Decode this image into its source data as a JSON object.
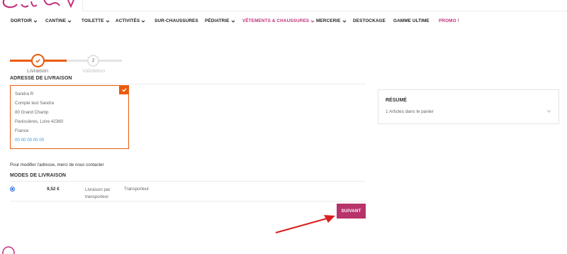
{
  "nav": {
    "items": [
      {
        "label": "DORTOIR",
        "has_dropdown": true
      },
      {
        "label": "CANTINE",
        "has_dropdown": true
      },
      {
        "label": "TOILETTE",
        "has_dropdown": true
      },
      {
        "label": "ACTIVITÉS",
        "has_dropdown": true
      },
      {
        "label": "SUR-CHAUSSURES",
        "has_dropdown": false
      },
      {
        "label": "PÉDIATRIE",
        "has_dropdown": true
      },
      {
        "label": "VÊTEMENTS & CHAUSSURES",
        "has_dropdown": true,
        "highlighted": true
      },
      {
        "label": "MERCERIE",
        "has_dropdown": true
      },
      {
        "label": "DESTOCKAGE",
        "has_dropdown": false
      },
      {
        "label": "GAMME ULTIME",
        "has_dropdown": false
      },
      {
        "label": "PROMO !",
        "has_dropdown": false,
        "highlighted": true
      }
    ]
  },
  "stepper": {
    "steps": [
      {
        "label": "Livraison",
        "state": "completed",
        "icon": "check-icon"
      },
      {
        "label": "Validation",
        "number": "2",
        "state": "pending"
      }
    ]
  },
  "shipping": {
    "title": "ADRESSE DE LIVRAISON",
    "address": {
      "name": "Sandra R",
      "company": "Compte test Sandra",
      "street": "80 Grand Champ",
      "city": "Panissières, Loire 42360",
      "country": "France",
      "phone": "00 00 00 00 00",
      "selected": true
    },
    "modify_note": "Pour modifier l'adresse, merci de nous contacter"
  },
  "delivery": {
    "title": "MODES DE LIVRAISON",
    "options": [
      {
        "price": "9,52 €",
        "method": "Livraison par transporteur",
        "carrier": "Transporteur",
        "selected": true
      }
    ],
    "next_label": "SUIVANT"
  },
  "summary": {
    "title": "RÉSUMÉ",
    "items_text": "1 Articles dans le panier"
  },
  "colors": {
    "accent_orange": "#ea5b0c",
    "brand_pink": "#c2307b",
    "button_magenta": "#b8336a",
    "arrow_red": "#d9201f",
    "link_blue": "#3a9ad9"
  }
}
